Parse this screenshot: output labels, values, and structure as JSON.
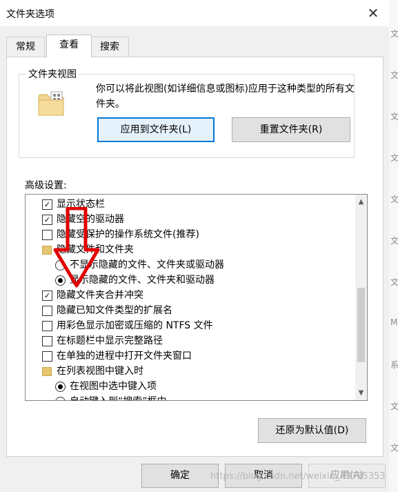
{
  "window": {
    "title": "文件夹选项",
    "close_symbol": "✕"
  },
  "tabs": [
    {
      "label": "常规"
    },
    {
      "label": "查看"
    },
    {
      "label": "搜索"
    }
  ],
  "folder_views": {
    "group_label": "文件夹视图",
    "description": "你可以将此视图(如详细信息或图标)应用于这种类型的所有文件夹。",
    "apply_button": "应用到文件夹(L)",
    "reset_button": "重置文件夹(R)"
  },
  "advanced": {
    "label": "高级设置:",
    "items": [
      {
        "type": "checkbox",
        "checked": true,
        "label": "显示状态栏",
        "indent": 0
      },
      {
        "type": "checkbox",
        "checked": true,
        "label": "隐藏空的驱动器",
        "indent": 0
      },
      {
        "type": "checkbox",
        "checked": false,
        "label": "隐藏受保护的操作系统文件(推荐)",
        "indent": 0
      },
      {
        "type": "folder",
        "label": "隐藏文件和文件夹",
        "indent": 0
      },
      {
        "type": "radio",
        "checked": false,
        "label": "不显示隐藏的文件、文件夹或驱动器",
        "indent": 1
      },
      {
        "type": "radio",
        "checked": true,
        "label": "显示隐藏的文件、文件夹和驱动器",
        "indent": 1
      },
      {
        "type": "checkbox",
        "checked": true,
        "label": "隐藏文件夹合并冲突",
        "indent": 0
      },
      {
        "type": "checkbox",
        "checked": false,
        "label": "隐藏已知文件类型的扩展名",
        "indent": 0
      },
      {
        "type": "checkbox",
        "checked": false,
        "label": "用彩色显示加密或压缩的 NTFS 文件",
        "indent": 0
      },
      {
        "type": "checkbox",
        "checked": false,
        "label": "在标题栏中显示完整路径",
        "indent": 0
      },
      {
        "type": "checkbox",
        "checked": false,
        "label": "在单独的进程中打开文件夹窗口",
        "indent": 0
      },
      {
        "type": "folder",
        "label": "在列表视图中键入时",
        "indent": 0
      },
      {
        "type": "radio",
        "checked": true,
        "label": "在视图中选中键入项",
        "indent": 1
      },
      {
        "type": "radio",
        "checked": false,
        "label": "自动键入到“搜索”框中",
        "indent": 1
      }
    ],
    "restore_button": "还原为默认值(D)"
  },
  "footer": {
    "ok": "确定",
    "cancel": "取消",
    "apply": "应用(A)"
  },
  "watermark": "https://blog.csdn.net/weixin_43735353",
  "colors": {
    "accent": "#0078d7",
    "arrow": "#e00000"
  }
}
